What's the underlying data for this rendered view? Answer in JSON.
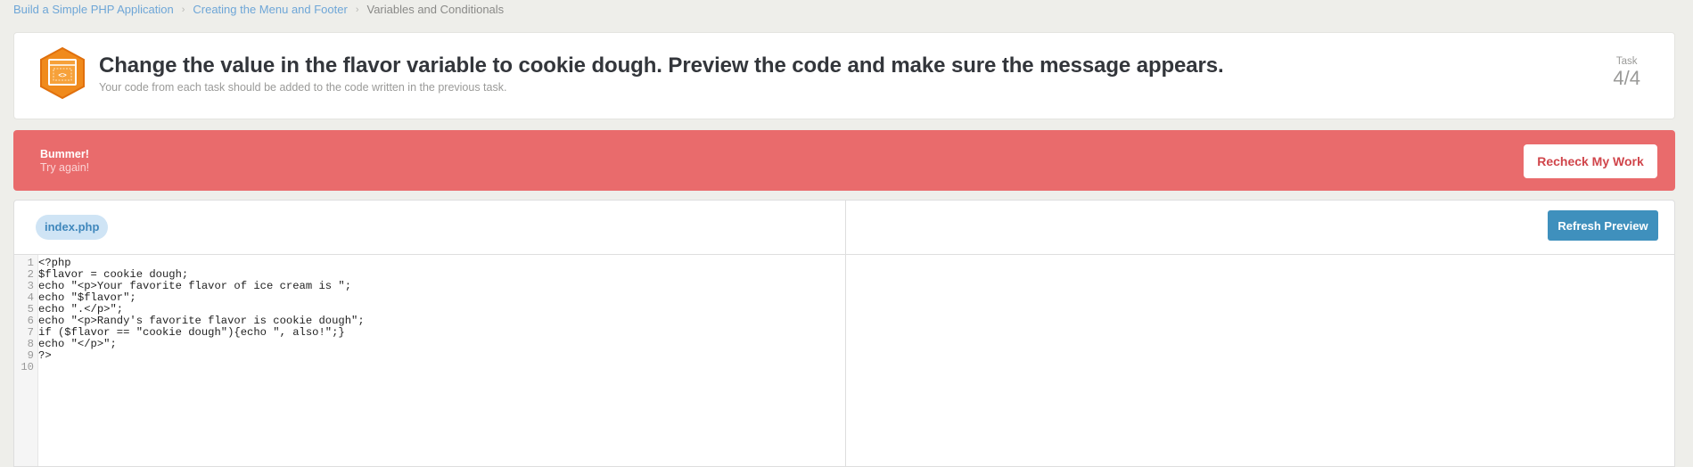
{
  "breadcrumb": {
    "items": [
      {
        "label": "Build a Simple PHP Application",
        "link": true
      },
      {
        "label": "Creating the Menu and Footer",
        "link": true
      },
      {
        "label": "Variables and Conditionals",
        "link": false
      }
    ],
    "separator": "›"
  },
  "task": {
    "icon": "code-window-hexagon-icon",
    "title": "Change the value in the flavor variable to cookie dough. Preview the code and make sure the message appears.",
    "subtitle": "Your code from each task should be added to the code written in the previous task.",
    "counter_label": "Task",
    "counter_value": "4/4"
  },
  "alert": {
    "title": "Bummer!",
    "message": "Try again!",
    "button_label": "Recheck My Work",
    "color": "#e96b6c"
  },
  "editor": {
    "file_tab": "index.php",
    "refresh_label": "Refresh Preview",
    "lines": [
      {
        "n": "1",
        "text": "<?php"
      },
      {
        "n": "2",
        "text": "$flavor = cookie dough;"
      },
      {
        "n": "3",
        "text": "echo \"<p>Your favorite flavor of ice cream is \";"
      },
      {
        "n": "4",
        "text": "echo \"$flavor\";"
      },
      {
        "n": "5",
        "text": "echo \".</p>\";"
      },
      {
        "n": "6",
        "text": "echo \"<p>Randy's favorite flavor is cookie dough\";"
      },
      {
        "n": "7",
        "text": "if ($flavor == \"cookie dough\"){echo \", also!\";}"
      },
      {
        "n": "8",
        "text": "echo \"</p>\";"
      },
      {
        "n": "9",
        "text": "?>"
      },
      {
        "n": "10",
        "text": ""
      }
    ]
  },
  "colors": {
    "accent_blue": "#3f90bd",
    "link": "#6ea6d7",
    "alert_red": "#e96b6c",
    "icon_orange": "#f08a1c"
  }
}
